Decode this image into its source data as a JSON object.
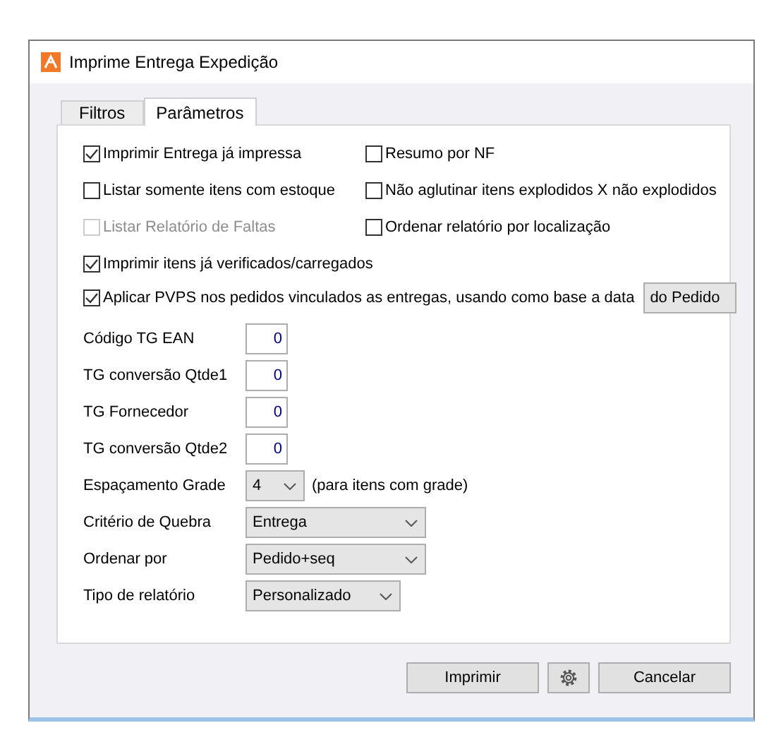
{
  "window": {
    "title": "Imprime Entrega Expedição"
  },
  "tabs": [
    {
      "label": "Filtros",
      "selected": false
    },
    {
      "label": "Parâmetros",
      "selected": true
    }
  ],
  "options": [
    {
      "label": "Imprimir Entrega já impressa",
      "checked": true,
      "disabled": false
    },
    {
      "label": "Resumo por NF",
      "checked": false,
      "disabled": false
    },
    {
      "label": "Listar somente itens com estoque",
      "checked": false,
      "disabled": false
    },
    {
      "label": "Não aglutinar itens explodidos X não explodidos",
      "checked": false,
      "disabled": false
    },
    {
      "label": "Listar Relatório de Faltas",
      "checked": false,
      "disabled": true
    },
    {
      "label": "Ordenar relatório por localização",
      "checked": false,
      "disabled": false
    }
  ],
  "wide_options": [
    {
      "label": "Imprimir itens já verificados/carregados",
      "checked": true
    },
    {
      "label": "Aplicar PVPS nos pedidos vinculados as entregas, usando como base a data",
      "checked": true,
      "select": "do Pedido"
    }
  ],
  "fields": [
    {
      "kind": "number",
      "label": "Código TG EAN",
      "value": "0"
    },
    {
      "kind": "number",
      "label": "TG conversão Qtde1",
      "value": "0"
    },
    {
      "kind": "number",
      "label": "TG Fornecedor",
      "value": "0"
    },
    {
      "kind": "number",
      "label": "TG conversão Qtde2",
      "value": "0"
    },
    {
      "kind": "select",
      "label": "Espaçamento Grade",
      "value": "4",
      "note": "(para itens com grade)"
    },
    {
      "kind": "select",
      "label": "Critério de Quebra",
      "value": "Entrega"
    },
    {
      "kind": "select",
      "label": "Ordenar por",
      "value": "Pedido+seq"
    },
    {
      "kind": "select",
      "label": "Tipo de relatório",
      "value": "Personalizado"
    }
  ],
  "buttons": [
    {
      "kind": "text",
      "label": "Imprimir"
    },
    {
      "kind": "settings"
    },
    {
      "kind": "text",
      "label": "Cancelar"
    }
  ]
}
